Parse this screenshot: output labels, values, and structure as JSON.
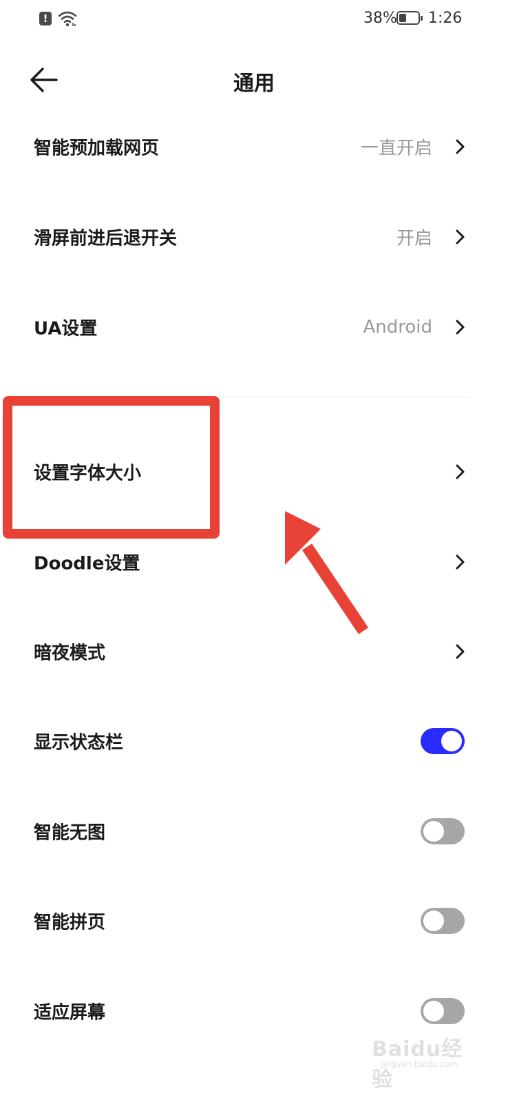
{
  "status_bar": {
    "battery_percent": "38%",
    "battery_level": 0.38,
    "time": "1:26",
    "icons": [
      "alert-icon",
      "wifi-icon",
      "battery-icon"
    ]
  },
  "header": {
    "title": "通用",
    "back_icon": "back-arrow-icon"
  },
  "settings": [
    {
      "label": "智能预加载网页",
      "value": "一直开启",
      "control": "chevron"
    },
    {
      "label": "滑屏前进后退开关",
      "value": "开启",
      "control": "chevron"
    },
    {
      "label": "UA设置",
      "value": "Android",
      "control": "chevron"
    },
    {
      "label": "设置字体大小",
      "value": "",
      "control": "chevron"
    },
    {
      "label": "Doodle设置",
      "value": "",
      "control": "chevron"
    },
    {
      "label": "暗夜模式",
      "value": "",
      "control": "chevron"
    },
    {
      "label": "显示状态栏",
      "control": "toggle",
      "on": true
    },
    {
      "label": "智能无图",
      "control": "toggle",
      "on": false
    },
    {
      "label": "智能拼页",
      "control": "toggle",
      "on": false
    },
    {
      "label": "适应屏幕",
      "control": "toggle",
      "on": false
    }
  ],
  "colors": {
    "toggle_on": "#2b2bff",
    "toggle_off": "#a6a6a6",
    "annotation": "#e84236",
    "value_text": "#999999"
  },
  "annotation": {
    "highlighted_item": "设置字体大小"
  },
  "watermark": {
    "text": "Baidu经验",
    "sub": "jingyan.baidu.com"
  }
}
